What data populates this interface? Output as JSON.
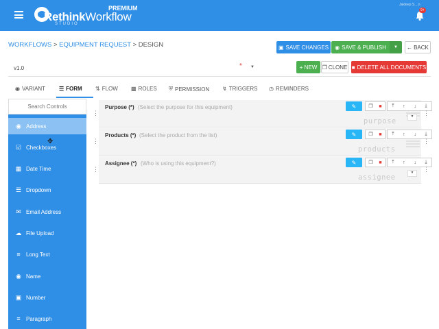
{
  "topbar": {
    "brand_bold": "Rethink",
    "brand_thin": "Workflow",
    "brand_sub": "STUDIO",
    "plan": "PREMIUM",
    "user": "Jaideep S....n",
    "notif_count": "9+",
    "accent": "#2f8ee5"
  },
  "breadcrumb": {
    "workflows": "WORKFLOWS",
    "sep1": " > ",
    "equipment": "EQUIPMENT REQUEST",
    "sep2": " > ",
    "current": "DESIGN"
  },
  "actions": {
    "save": "SAVE CHANGES",
    "publish": "SAVE & PUBLISH",
    "back": "BACK"
  },
  "version": {
    "value": "v1.0",
    "required": "*",
    "new": "+ NEW",
    "clone": "CLONE",
    "delete_all": "DELETE ALL DOCUMENTS"
  },
  "tabs": [
    {
      "label": "VARIANT",
      "icon": "eye-icon"
    },
    {
      "label": "FORM",
      "icon": "list-icon"
    },
    {
      "label": "FLOW",
      "icon": "flow-icon"
    },
    {
      "label": "ROLES",
      "icon": "roles-icon"
    },
    {
      "label": "PERMISSION",
      "icon": "shield-icon"
    },
    {
      "label": "TRIGGERS",
      "icon": "bolt-icon"
    },
    {
      "label": "REMINDERS",
      "icon": "clock-icon"
    }
  ],
  "sidebar": {
    "search": "Search Controls",
    "items": [
      {
        "label": "Address",
        "icon": "map-pin-icon"
      },
      {
        "label": "Checkboxes",
        "icon": "checkbox-icon"
      },
      {
        "label": "Date Time",
        "icon": "calendar-icon"
      },
      {
        "label": "Dropdown",
        "icon": "dropdown-icon"
      },
      {
        "label": "Email Address",
        "icon": "email-icon"
      },
      {
        "label": "File Upload",
        "icon": "cloud-upload-icon"
      },
      {
        "label": "Long Text",
        "icon": "long-text-icon"
      },
      {
        "label": "Name",
        "icon": "name-icon"
      },
      {
        "label": "Number",
        "icon": "number-icon"
      },
      {
        "label": "Paragraph",
        "icon": "paragraph-icon"
      }
    ]
  },
  "fields": [
    {
      "label": "Purpose (*)",
      "placeholder": "(Select the purpose for this equipment)",
      "key": "purpose"
    },
    {
      "label": "Products (*)",
      "placeholder": "(Select the product from the list)",
      "key": "products"
    },
    {
      "label": "Assignee (*)",
      "placeholder": "(Who is using this equipment?)",
      "key": "assignee"
    }
  ]
}
